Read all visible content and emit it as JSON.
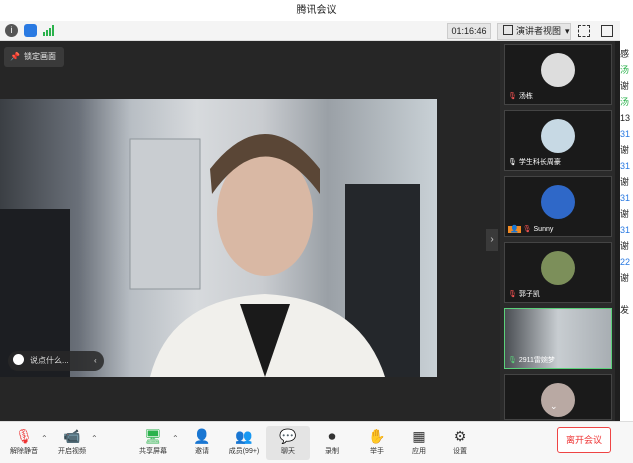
{
  "window": {
    "title": "腾讯会议"
  },
  "status": {
    "timer": "01:16:46",
    "view_label": "演讲者视图"
  },
  "main_view": {
    "lock_label": "锁定画面",
    "chat_placeholder": "说点什么..."
  },
  "participants": [
    {
      "name": "汤栋"
    },
    {
      "name": "学生科长周豪"
    },
    {
      "name": "Sunny"
    },
    {
      "name": "郭子凯"
    },
    {
      "name": "2911雷婉梦"
    }
  ],
  "chat_fragments": [
    "感",
    "汤",
    "谢",
    "汤",
    "13",
    "31",
    "谢",
    "31",
    "谢",
    "31",
    "谢",
    "31",
    "谢",
    "22",
    "谢",
    "发"
  ],
  "toolbar": {
    "mute": "解除静音",
    "video": "开启视频",
    "share": "共享屏幕",
    "invite": "邀请",
    "members": "成员(99+)",
    "chat": "聊天",
    "record": "录制",
    "raise": "举手",
    "apps": "应用",
    "settings": "设置",
    "leave": "离开会议"
  },
  "colors": {
    "leave": "#e33333",
    "signal": "#2bb24c",
    "active_tile": "#5bd17a"
  }
}
